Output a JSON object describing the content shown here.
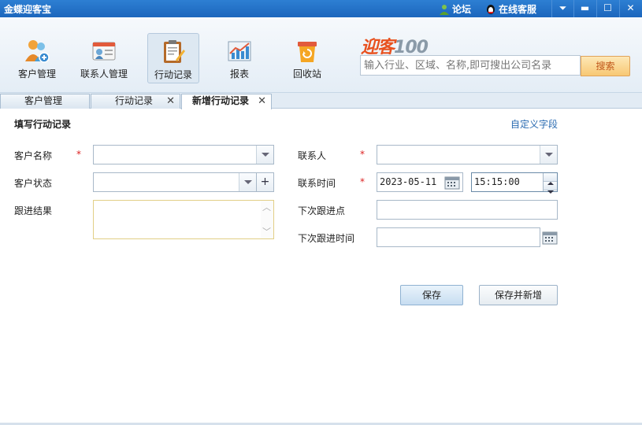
{
  "titlebar": {
    "app_title": "金蝶迎客宝",
    "forum_label": "论坛",
    "support_label": "在线客服",
    "buttons": [
      "dropdown",
      "minimize",
      "maximize",
      "close"
    ]
  },
  "toolbar": {
    "items": [
      {
        "label": "客户管理",
        "icon": "customers-icon"
      },
      {
        "label": "联系人管理",
        "icon": "contact-card-icon"
      },
      {
        "label": "行动记录",
        "icon": "clipboard-edit-icon"
      },
      {
        "label": "报表",
        "icon": "chart-icon"
      },
      {
        "label": "回收站",
        "icon": "recycle-bin-icon"
      }
    ],
    "active_index": 2,
    "logo": {
      "part1": "迎客",
      "part2": "100"
    },
    "search": {
      "placeholder": "输入行业、区域、名称,即可搜出公司名录",
      "button_label": "搜索"
    }
  },
  "tabs": [
    {
      "label": "客户管理",
      "closable": false,
      "active": false
    },
    {
      "label": "行动记录",
      "closable": true,
      "active": false
    },
    {
      "label": "新增行动记录",
      "closable": true,
      "active": true
    }
  ],
  "form": {
    "title": "填写行动记录",
    "custom_fields_link": "自定义字段",
    "required_mark": "*",
    "labels": {
      "customer_name": "客户名称",
      "customer_status": "客户状态",
      "follow_result": "跟进结果",
      "contact": "联系人",
      "contact_time": "联系时间",
      "next_follow_point": "下次跟进点",
      "next_follow_time": "下次跟进时间"
    },
    "values": {
      "customer_name": "",
      "customer_status": "",
      "follow_result": "",
      "contact": "",
      "contact_date": "2023-05-11",
      "contact_clock": "15:15:00",
      "next_follow_point": "",
      "next_follow_time": ""
    },
    "buttons": {
      "save": "保存",
      "save_and_new": "保存并新增"
    }
  },
  "colors": {
    "titlebar": "#1c66bd",
    "required": "#dd2222",
    "link": "#2a6bb1",
    "logo_orange": "#e8511f"
  }
}
